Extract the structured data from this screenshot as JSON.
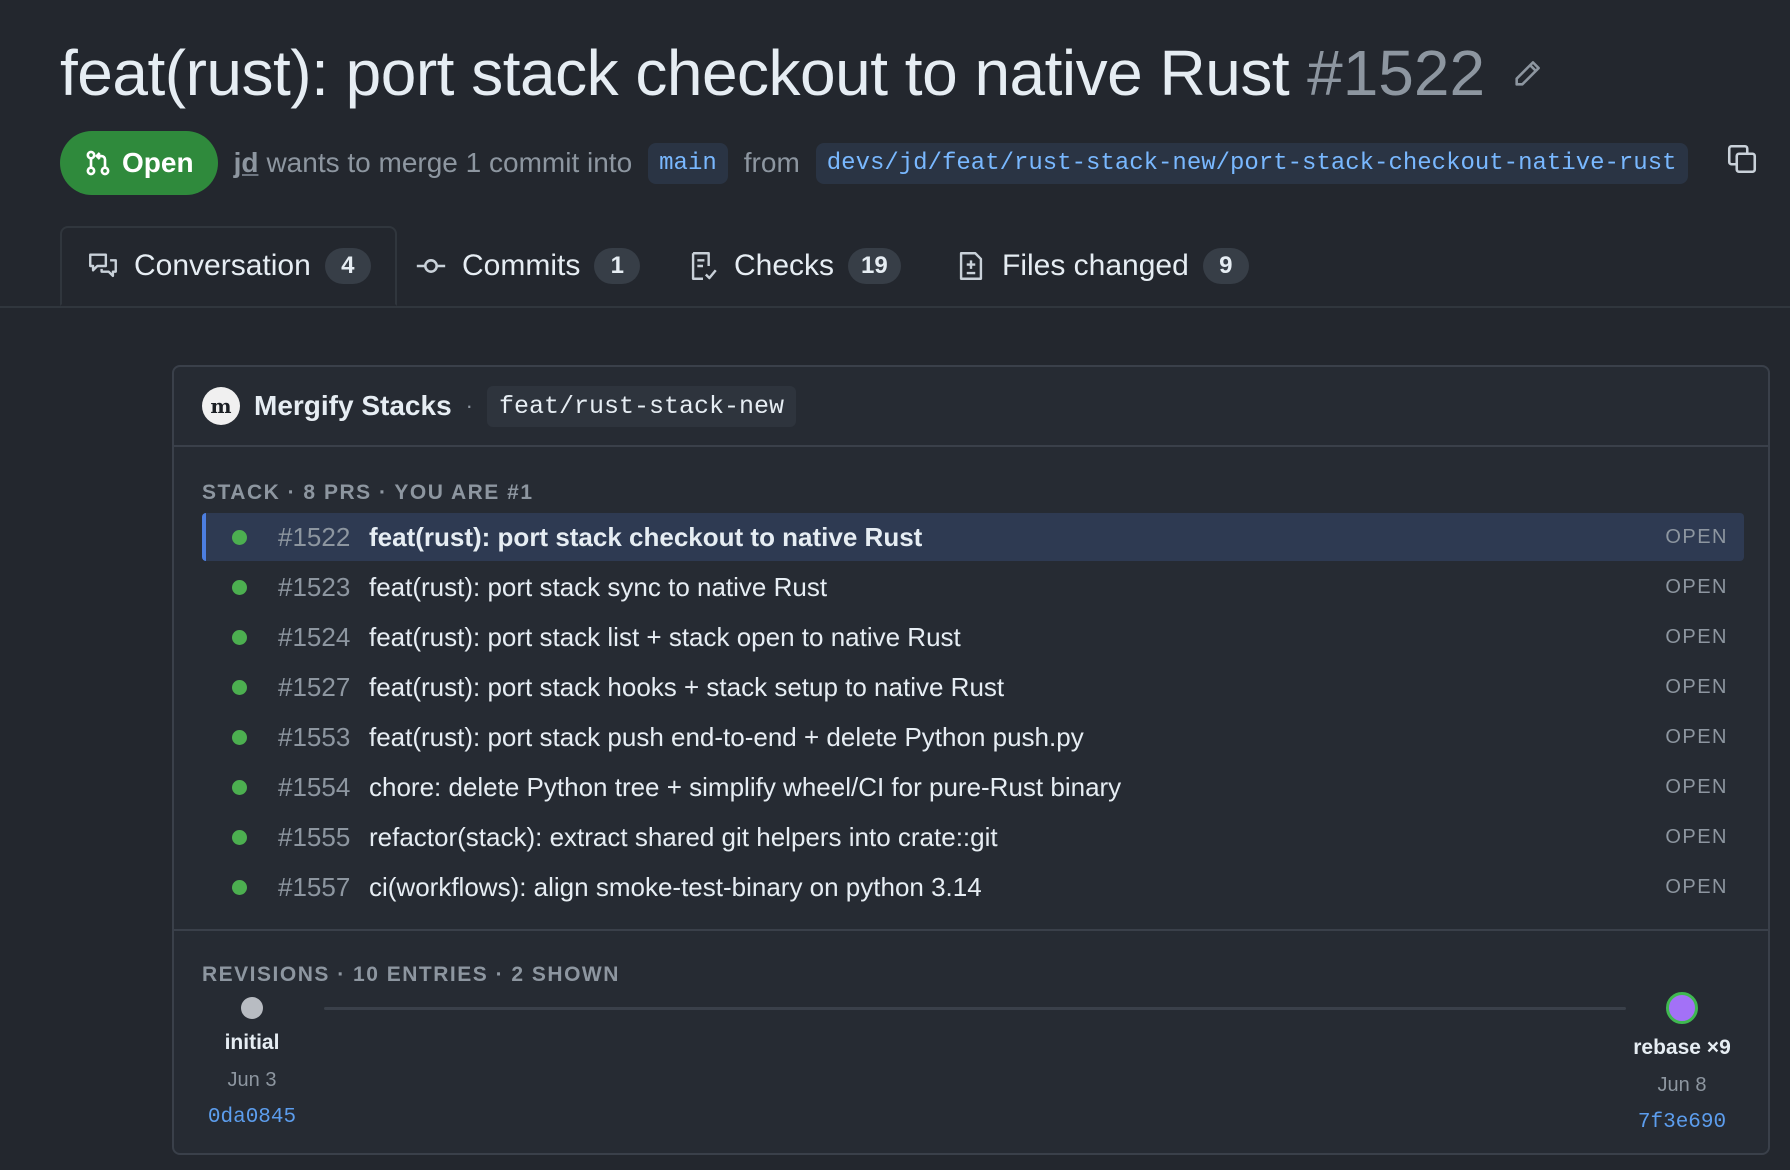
{
  "pr": {
    "title": "feat(rust): port stack checkout to native Rust",
    "number": "#1522",
    "state": "Open",
    "author": "jd",
    "merge_text": "wants to merge 1 commit into",
    "base_branch": "main",
    "from_text": "from",
    "head_branch": "devs/jd/feat/rust-stack-new/port-stack-checkout-native-rust"
  },
  "tabs": [
    {
      "label": "Conversation",
      "count": "4",
      "icon": "comment-discussion-icon"
    },
    {
      "label": "Commits",
      "count": "1",
      "icon": "git-commit-icon"
    },
    {
      "label": "Checks",
      "count": "19",
      "icon": "checklist-icon"
    },
    {
      "label": "Files changed",
      "count": "9",
      "icon": "file-diff-icon"
    }
  ],
  "stack_panel": {
    "app_logo": "m",
    "app_name": "Mergify Stacks",
    "separator": "·",
    "stack_branch": "feat/rust-stack-new",
    "stack_label": "STACK · 8 PRS · YOU ARE #1",
    "items": [
      {
        "number": "#1522",
        "title": "feat(rust): port stack checkout to native Rust",
        "state": "OPEN",
        "current": true
      },
      {
        "number": "#1523",
        "title": "feat(rust): port stack sync to native Rust",
        "state": "OPEN"
      },
      {
        "number": "#1524",
        "title": "feat(rust): port stack list + stack open to native Rust",
        "state": "OPEN"
      },
      {
        "number": "#1527",
        "title": "feat(rust): port stack hooks + stack setup to native Rust",
        "state": "OPEN"
      },
      {
        "number": "#1553",
        "title": "feat(rust): port stack push end-to-end + delete Python push.py",
        "state": "OPEN"
      },
      {
        "number": "#1554",
        "title": "chore: delete Python tree + simplify wheel/CI for pure-Rust binary",
        "state": "OPEN"
      },
      {
        "number": "#1555",
        "title": "refactor(stack): extract shared git helpers into crate::git",
        "state": "OPEN"
      },
      {
        "number": "#1557",
        "title": "ci(workflows): align smoke-test-binary on python 3.14",
        "state": "OPEN"
      }
    ],
    "revisions_label": "REVISIONS · 10 ENTRIES · 2 SHOWN",
    "revisions": [
      {
        "name": "initial",
        "date": "Jun 3",
        "sha": "0da0845"
      },
      {
        "name": "rebase ×9",
        "date": "Jun 8",
        "sha": "7f3e690"
      }
    ]
  },
  "colors": {
    "open_green": "#2f8a3c",
    "status_dot": "#4caf50",
    "link_blue": "#5c9ded",
    "current_row": "#2e3a52",
    "current_revision": "#a371f7"
  }
}
